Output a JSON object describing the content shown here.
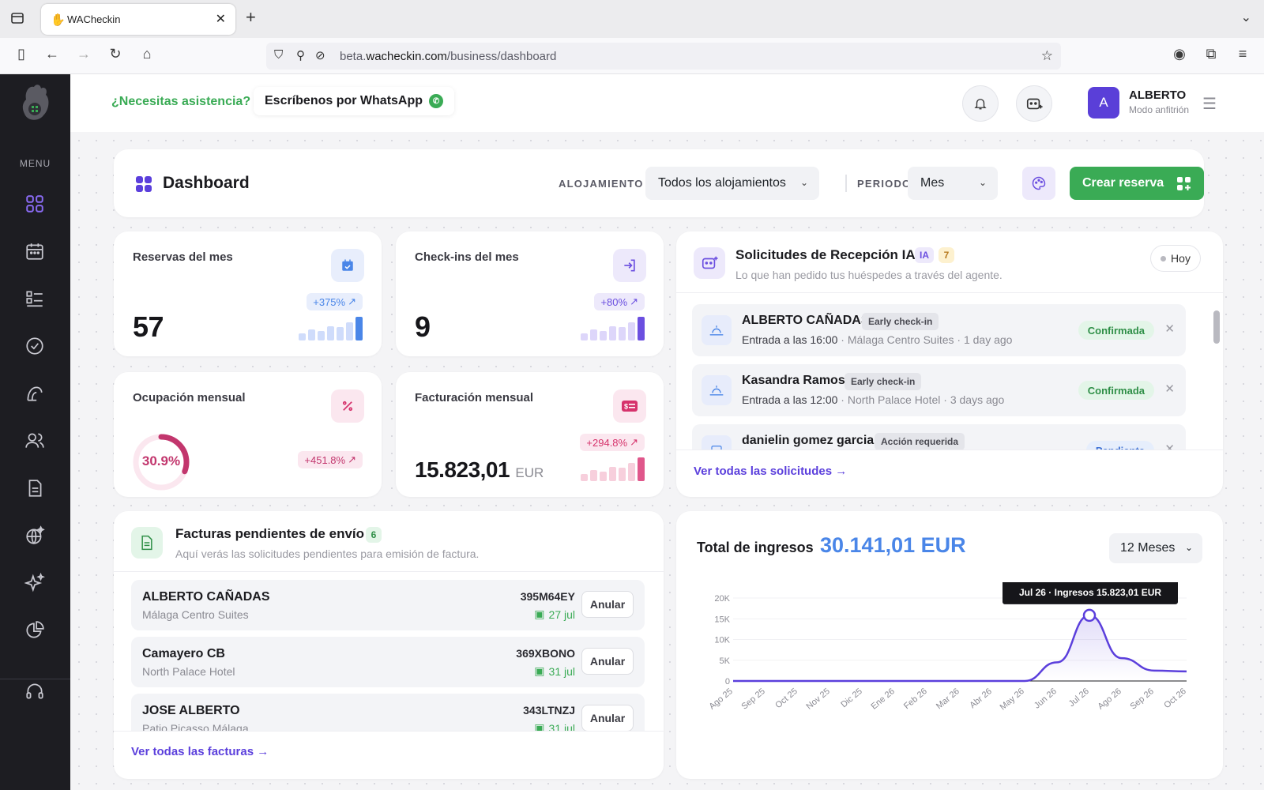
{
  "browser": {
    "tab_title": "WACheckin",
    "url_prefix": "beta.",
    "url_domain": "wacheckin.com",
    "url_path": "/business/dashboard"
  },
  "sidebar": {
    "menu_label": "MENU",
    "items": [
      {
        "icon": "grid-icon",
        "active": true
      },
      {
        "icon": "calendar-icon"
      },
      {
        "icon": "list-icon"
      },
      {
        "icon": "check-circle-icon"
      },
      {
        "icon": "reception-icon"
      },
      {
        "icon": "users-icon"
      },
      {
        "icon": "document-icon"
      },
      {
        "icon": "ai-globe-icon"
      },
      {
        "icon": "sparkles-icon"
      },
      {
        "icon": "pie-chart-icon"
      },
      {
        "icon": "headset-icon"
      }
    ]
  },
  "header": {
    "help_question": "¿Necesitas asistencia?",
    "help_cta": "Escríbenos por WhatsApp",
    "user_initial": "A",
    "user_name": "ALBERTO",
    "user_mode": "Modo anfitrión"
  },
  "dashboard": {
    "title": "Dashboard",
    "accommodation_label": "ALOJAMIENTO",
    "accommodation_value": "Todos los alojamientos",
    "period_label": "PERIODO",
    "period_value": "Mes",
    "create_label": "Crear reserva"
  },
  "kpis": {
    "reservas": {
      "label": "Reservas del mes",
      "value": "57",
      "trend": "+375%",
      "bars": [
        0.3,
        0.45,
        0.4,
        0.6,
        0.55,
        0.75,
        1.0
      ]
    },
    "checkins": {
      "label": "Check-ins del mes",
      "value": "9",
      "trend": "+80%",
      "bars": [
        0.3,
        0.45,
        0.4,
        0.6,
        0.55,
        0.75,
        1.0
      ]
    },
    "ocupacion": {
      "label": "Ocupación mensual",
      "value": "30.9%",
      "fraction": 0.309,
      "trend": "+451.8%"
    },
    "facturacion": {
      "label": "Facturación mensual",
      "value": "15.823,01",
      "unit": "EUR",
      "trend": "+294.8%",
      "bars": [
        0.3,
        0.45,
        0.4,
        0.6,
        0.55,
        0.75,
        1.0
      ]
    }
  },
  "requests": {
    "title": "Solicitudes de Recepción IA",
    "ia_badge": "IA",
    "count": "7",
    "subtitle": "Lo que han pedido tus huéspedes a través del agente.",
    "today_label": "Hoy",
    "items": [
      {
        "name": "ALBERTO CAÑADAS",
        "tag": "Early check-in",
        "time": "Entrada a las 16:00",
        "place": "Málaga Centro Suites",
        "ago": "1 day ago",
        "status": "Confirmada"
      },
      {
        "name": "Kasandra Ramos",
        "tag": "Early check-in",
        "time": "Entrada a las 12:00",
        "place": "North Palace Hotel",
        "ago": "3 days ago",
        "status": "Confirmada"
      },
      {
        "name": "danielin gomez garcia",
        "tag": "Acción requerida",
        "time": "",
        "place": "",
        "ago": "",
        "status": "Pendiente"
      }
    ],
    "view_all": "Ver todas las solicitudes"
  },
  "invoices": {
    "title": "Facturas pendientes de envío",
    "count": "6",
    "subtitle": "Aquí verás las solicitudes pendientes para emisión de factura.",
    "items": [
      {
        "name": "ALBERTO CAÑADAS",
        "place": "Málaga Centro Suites",
        "code": "395M64EY",
        "date": "27 jul",
        "action": "Anular"
      },
      {
        "name": "Camayero CB",
        "place": "North Palace Hotel",
        "code": "369XBONO",
        "date": "31 jul",
        "action": "Anular"
      },
      {
        "name": "JOSE ALBERTO",
        "place": "Patio Picasso Málaga",
        "code": "343LTNZJ",
        "date": "31 jul",
        "action": "Anular"
      }
    ],
    "view_all": "Ver todas las facturas"
  },
  "income": {
    "title": "Total de ingresos",
    "total": "30.141,01 EUR",
    "range": "12 Meses",
    "tooltip": "Jul 26 · Ingresos 15.823,01 EUR"
  },
  "chart_data": {
    "type": "area",
    "x": [
      "Ago 25",
      "Sep 25",
      "Oct 25",
      "Nov 25",
      "Dic 25",
      "Ene 26",
      "Feb 26",
      "Mar 26",
      "Abr 26",
      "May 26",
      "Jun 26",
      "Jul 26",
      "Ago 26",
      "Sep 26",
      "Oct 26"
    ],
    "values": [
      0,
      0,
      0,
      0,
      0,
      0,
      0,
      0,
      0,
      0,
      4500,
      15823.01,
      5500,
      2500,
      2300
    ],
    "yticks": [
      "0",
      "5K",
      "10K",
      "15K",
      "20K"
    ],
    "ylim": [
      0,
      20000
    ],
    "highlight_index": 11,
    "color": "#5b3fdc"
  },
  "colors": {
    "brand_purple": "#5b3fdc",
    "brand_green": "#3aab55",
    "accent_blue": "#4a86e8",
    "accent_pink": "#d6336c"
  }
}
